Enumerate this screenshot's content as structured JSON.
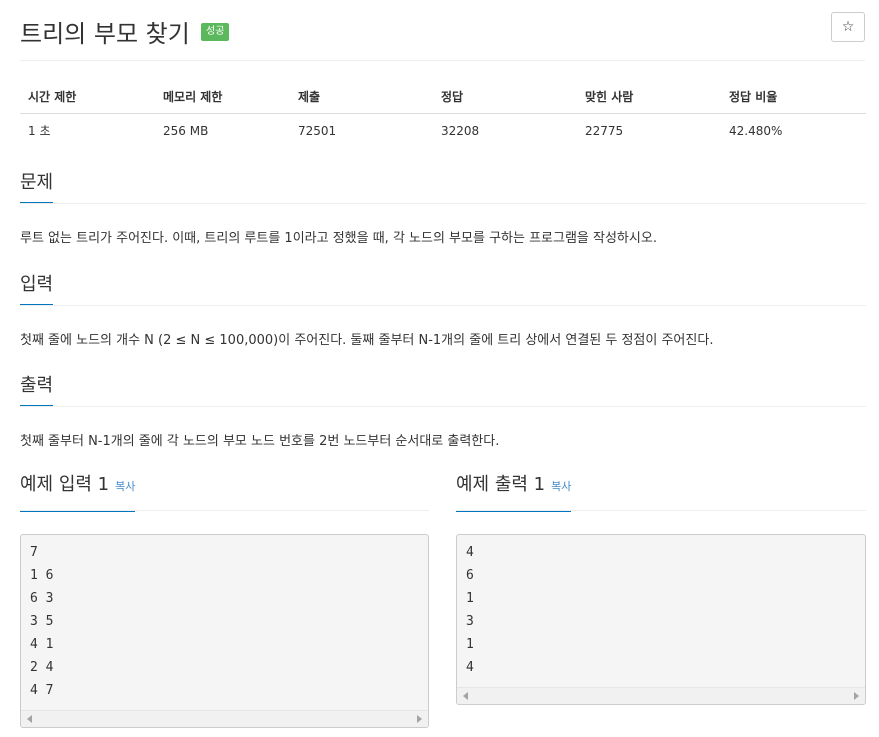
{
  "header": {
    "title": "트리의 부모 찾기",
    "badge": "성공",
    "star_label": "☆"
  },
  "info": {
    "columns": [
      "시간 제한",
      "메모리 제한",
      "제출",
      "정답",
      "맞힌 사람",
      "정답 비율"
    ],
    "values": [
      "1 초",
      "256 MB",
      "72501",
      "32208",
      "22775",
      "42.480%"
    ]
  },
  "problem": {
    "title": "문제",
    "text": "루트 없는 트리가 주어진다. 이때, 트리의 루트를 1이라고 정했을 때, 각 노드의 부모를 구하는 프로그램을 작성하시오."
  },
  "input": {
    "title": "입력",
    "text": "첫째 줄에 노드의 개수 N (2 ≤ N ≤ 100,000)이 주어진다. 둘째 줄부터 N-1개의 줄에 트리 상에서 연결된 두 정점이 주어진다."
  },
  "output": {
    "title": "출력",
    "text": "첫째 줄부터 N-1개의 줄에 각 노드의 부모 노드 번호를 2번 노드부터 순서대로 출력한다."
  },
  "sample_input": {
    "title": "예제 입력 1",
    "copy": "복사",
    "lines": [
      "7",
      "1 6",
      "6 3",
      "3 5",
      "4 1",
      "2 4",
      "4 7"
    ]
  },
  "sample_output": {
    "title": "예제 출력 1",
    "copy": "복사",
    "lines": [
      "4",
      "6",
      "1",
      "3",
      "1",
      "4"
    ]
  }
}
